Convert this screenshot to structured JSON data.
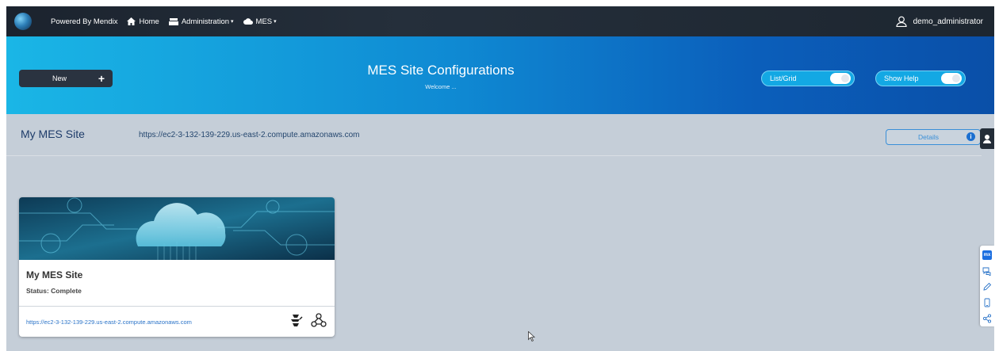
{
  "nav": {
    "powered_by": "Powered By Mendix",
    "home": "Home",
    "administration": "Administration",
    "mes": "MES",
    "caret": "▾",
    "user": "demo_administrator"
  },
  "banner": {
    "new_label": "New",
    "new_icon": "+",
    "title": "MES Site Configurations",
    "subtitle": "Welcome ...",
    "list_grid_label": "List/Grid",
    "show_help_label": "Show Help"
  },
  "site": {
    "name": "My MES Site",
    "url": "https://ec2-3-132-139-229.us-east-2.compute.amazonaws.com",
    "details_label": "Details",
    "info_glyph": "i"
  },
  "card": {
    "title": "My MES Site",
    "status": "Status: Complete",
    "url": "https://ec2-3-132-139-229.us-east-2.compute.amazonaws.com"
  },
  "toolstrip": {
    "mx_label": "mx"
  },
  "colors": {
    "banner_start": "#1ab6e6",
    "banner_end": "#0a4fa8",
    "nav_bg": "#1b232e",
    "page_bg": "#c5ced8",
    "accent_blue": "#2a73c8"
  }
}
